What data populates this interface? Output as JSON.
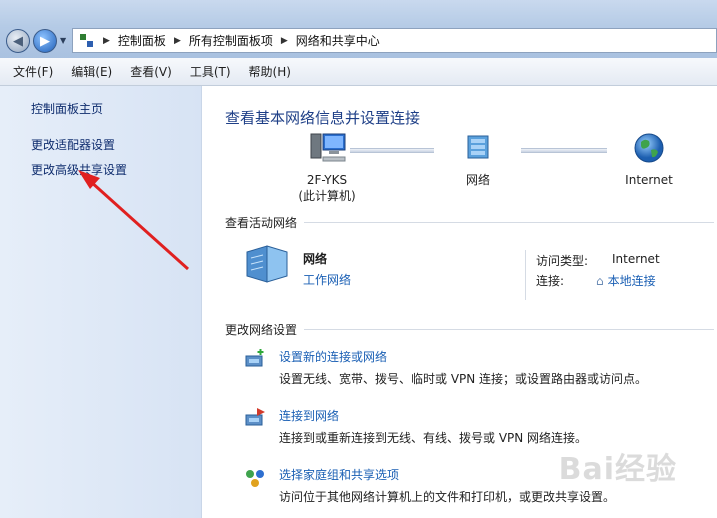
{
  "address_bar": {
    "crumbs": [
      "控制面板",
      "所有控制面板项",
      "网络和共享中心"
    ]
  },
  "menu": [
    "文件(F)",
    "编辑(E)",
    "查看(V)",
    "工具(T)",
    "帮助(H)"
  ],
  "left_pane": {
    "links": [
      "控制面板主页",
      "更改适配器设置",
      "更改高级共享设置"
    ]
  },
  "main": {
    "title": "查看基本网络信息并设置连接",
    "map": {
      "computer_name": "2F-YKS",
      "computer_sub": "(此计算机)",
      "network": "网络",
      "internet": "Internet"
    },
    "active_section": "查看活动网络",
    "active_network": {
      "name": "网络",
      "type": "工作网络",
      "access_type_label": "访问类型:",
      "access_type_value": "Internet",
      "connection_label": "连接:",
      "connection_value": "本地连接"
    },
    "change_section": "更改网络设置",
    "tasks": [
      {
        "title": "设置新的连接或网络",
        "desc": "设置无线、宽带、拨号、临时或 VPN 连接；或设置路由器或访问点。"
      },
      {
        "title": "连接到网络",
        "desc": "连接到或重新连接到无线、有线、拨号或 VPN 网络连接。"
      },
      {
        "title": "选择家庭组和共享选项",
        "desc": "访问位于其他网络计算机上的文件和打印机，或更改共享设置。"
      }
    ]
  },
  "watermark": "Bai经验",
  "colors": {
    "link": "#1a5fb4",
    "title": "#1e3f87",
    "arrow": "#e02020"
  }
}
